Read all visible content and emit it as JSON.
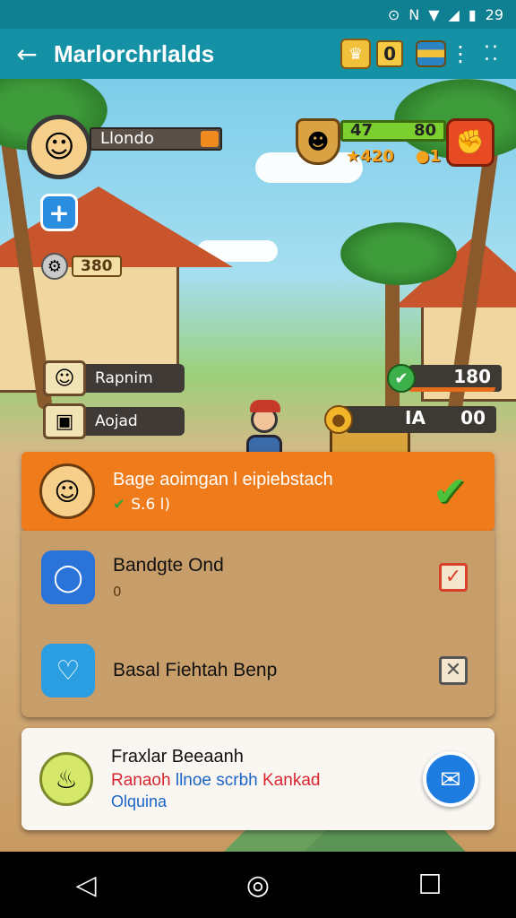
{
  "status_bar": {
    "time": "29"
  },
  "app_bar": {
    "title": "Marlorchrlalds",
    "gem_count": "0"
  },
  "player": {
    "name": "Llondo",
    "gear_count": "380"
  },
  "side_buttons": [
    {
      "label": "Rapnim"
    },
    {
      "label": "Aojad"
    }
  ],
  "top_stats": {
    "bar_left": "47",
    "bar_right": "80",
    "stars": "420",
    "coins": "1"
  },
  "resources": [
    {
      "value": "180",
      "fill": 0.93
    },
    {
      "label": "IA",
      "value": "00",
      "fill": 0.0
    }
  ],
  "quest_active": {
    "title": "Bage aoimgan l eipiebstach",
    "reward": "S.6 l)"
  },
  "quests": [
    {
      "name": "Bandgte  Ond",
      "sub": "0",
      "status": "checked"
    },
    {
      "name": "Basal Fiehtah Benp",
      "sub": "",
      "status": "crossed"
    }
  ],
  "notification": {
    "title": "Fraxlar Beeaanh",
    "line_red": "Ranaoh",
    "line_blue": "llnoe scrbh",
    "line_red2": "Kankad",
    "line3": "Olquina"
  },
  "colors": {
    "appbar": "#1591a6",
    "active_quest": "#f07b1a",
    "panel": "#c79d6a"
  }
}
